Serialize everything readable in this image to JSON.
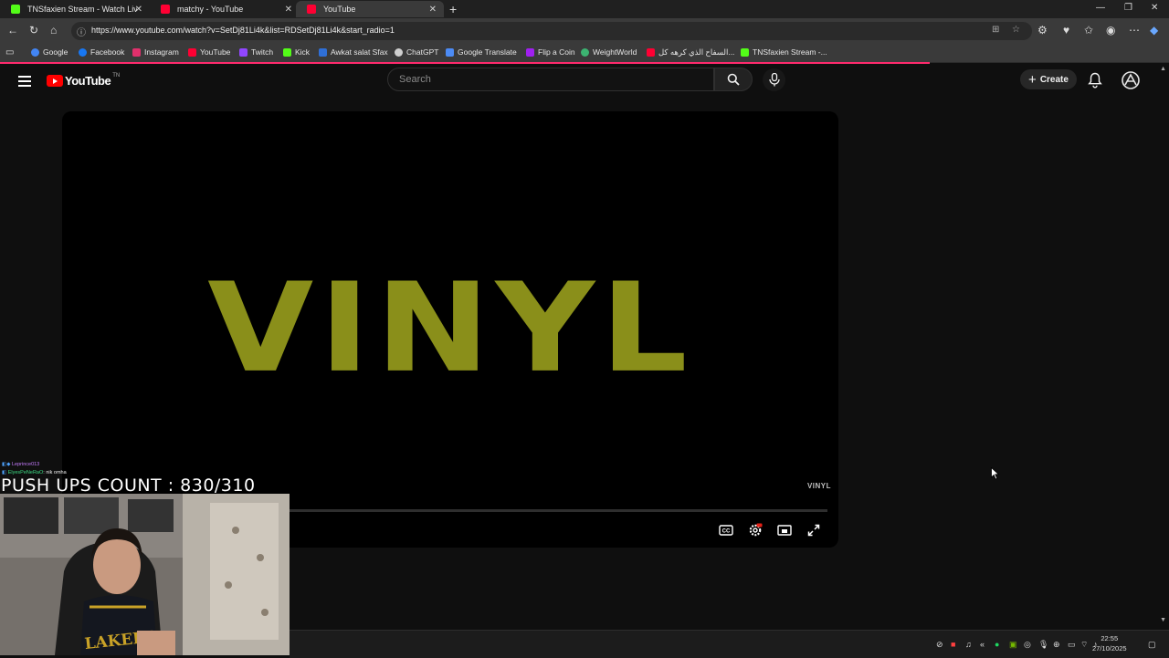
{
  "browser": {
    "tabs": [
      {
        "title": "TNSfaxien Stream - Watch Live on",
        "icon_color": "#53fc18"
      },
      {
        "title": "matchy - YouTube",
        "icon_color": "#ff0033"
      },
      {
        "title": "YouTube",
        "icon_color": "#ff0033"
      }
    ],
    "url": "https://www.youtube.com/watch?v=SetDj81Li4k&list=RDSetDj81Li4k&start_radio=1",
    "bookmarks": [
      {
        "label": "Google",
        "color": "#4285f4"
      },
      {
        "label": "Facebook",
        "color": "#1877f2"
      },
      {
        "label": "Instagram",
        "color": "#e1306c"
      },
      {
        "label": "YouTube",
        "color": "#ff0033"
      },
      {
        "label": "Twitch",
        "color": "#9146ff"
      },
      {
        "label": "Kick",
        "color": "#53fc18"
      },
      {
        "label": "Awkat salat Sfax",
        "color": "#2f6fd6"
      },
      {
        "label": "ChatGPT",
        "color": "#cfcfcf"
      },
      {
        "label": "Google Translate",
        "color": "#4c8bf5"
      },
      {
        "label": "Flip a Coin",
        "color": "#a020f0"
      },
      {
        "label": "WeightWorld",
        "color": "#3cb371"
      },
      {
        "label": "السفاح الذي كرهه كل...",
        "color": "#ff0033"
      },
      {
        "label": "TNSfaxien Stream -...",
        "color": "#53fc18"
      }
    ]
  },
  "youtube": {
    "logo_text": "YouTube",
    "country": "TN",
    "search_placeholder": "Search",
    "create_label": "Create"
  },
  "player": {
    "title_art": "VINYL",
    "watermark": "VINYL"
  },
  "overlay": {
    "chat": [
      {
        "user": "Leprince013",
        "message": ""
      },
      {
        "user": "ElyesPeNeRaO",
        "message": ": nik omha"
      }
    ],
    "pushups_text": "PUSH UPS COUNT : 830/310",
    "jersey_text": "LAKERS"
  },
  "taskbar": {
    "time": "22:55",
    "date": "27/10/2025"
  },
  "colors": {
    "accent_red": "#ff0000",
    "vinyl_olive": "#8a8f1a",
    "progress_pink": "#ff2a6d"
  }
}
